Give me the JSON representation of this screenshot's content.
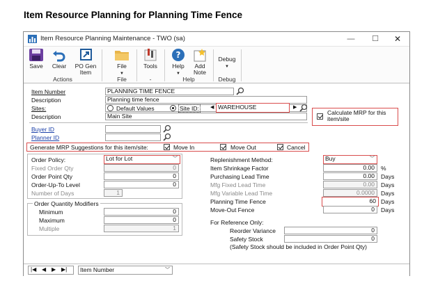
{
  "doc_title": "Item Resource Planning for Planning Time Fence",
  "window": {
    "title": "Item Resource Planning Maintenance  -  TWO (sa)",
    "minimize": "—",
    "maximize": "☐",
    "close": "✕"
  },
  "ribbon": {
    "save": "Save",
    "clear": "Clear",
    "po_gen_item": "PO Gen\nItem",
    "file": "File",
    "tools": "Tools",
    "help": "Help",
    "add_note": "Add\nNote",
    "debug": "Debug",
    "groups": {
      "actions": "Actions",
      "file": "File",
      "tools": "-",
      "help": "Help",
      "debug": "Debug"
    }
  },
  "form": {
    "item_number_label": "Item Number",
    "item_number_value": "PLANNING TIME FENCE",
    "description_label": "Description",
    "description_value": "Planning time fence",
    "sites_label": "Sites:",
    "default_values_label": "Default Values",
    "site_id_label": "Site ID:",
    "site_id_value": "WAREHOUSE",
    "site_description_label": "Description",
    "site_description_value": "Main Site",
    "calc_mrp_label": "Calculate MRP for this item/site",
    "buyer_id_label": "Buyer ID",
    "buyer_id_value": "",
    "planner_id_label": "Planner ID",
    "planner_id_value": "",
    "generate_label": "Generate MRP Suggestions for this item/site:",
    "move_in_label": "Move In",
    "move_out_label": "Move Out",
    "cancel_label": "Cancel",
    "left": {
      "order_policy_label": "Order Policy:",
      "order_policy_value": "Lot for Lot",
      "fixed_order_qty_label": "Fixed Order Qty",
      "fixed_order_qty_value": "0",
      "order_point_qty_label": "Order Point Qty",
      "order_point_qty_value": "0",
      "order_up_to_label": "Order-Up-To Level",
      "order_up_to_value": "0",
      "number_of_days_label": "Number of Days",
      "number_of_days_value": "1",
      "modifiers_title": "Order Quantity Modifiers",
      "minimum_label": "Minimum",
      "minimum_value": "0",
      "maximum_label": "Maximum",
      "maximum_value": "0",
      "multiple_label": "Multiple",
      "multiple_value": "1"
    },
    "right": {
      "replenishment_label": "Replenishment Method:",
      "replenishment_value": "Buy",
      "shrinkage_label": "Item Shrinkage Factor",
      "shrinkage_value": "0.00",
      "shrinkage_unit": "%",
      "purchasing_lead_label": "Purchasing Lead Time",
      "purchasing_lead_value": "0.00",
      "mfg_fixed_label": "Mfg Fixed Lead Time",
      "mfg_fixed_value": "0.00",
      "mfg_variable_label": "Mfg Variable Lead Time",
      "mfg_variable_value": "0.0000",
      "planning_fence_label": "Planning Time Fence",
      "planning_fence_value": "60",
      "move_out_fence_label": "Move-Out Fence",
      "move_out_fence_value": "0",
      "days_unit": "Days",
      "reference_label": "For Reference Only:",
      "reorder_variance_label": "Reorder Variance",
      "reorder_variance_value": "0",
      "safety_stock_label": "Safety Stock",
      "safety_stock_value": "0",
      "safety_note": "(Safety Stock should be included in Order Point Qty)"
    }
  },
  "navbar": {
    "sort_value": "Item Number"
  },
  "colors": {
    "highlight_red": "#d94c4c",
    "link_blue": "#1a3fa8"
  }
}
